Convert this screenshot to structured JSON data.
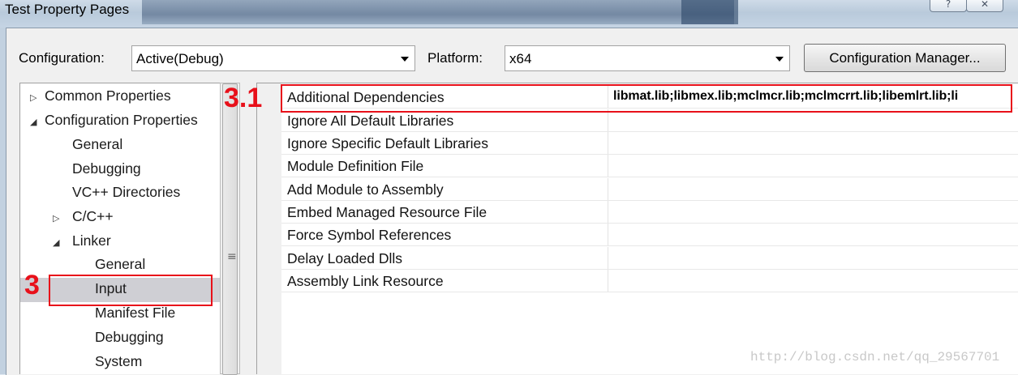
{
  "window": {
    "title": "Test Property Pages",
    "help_glyph": "?",
    "close_glyph": "✕"
  },
  "config_row": {
    "configuration_label": "Configuration:",
    "configuration_value": "Active(Debug)",
    "platform_label": "Platform:",
    "platform_value": "x64",
    "manager_button": "Configuration Manager..."
  },
  "tree": {
    "items": [
      {
        "label": "Common Properties",
        "twisty": "▷"
      },
      {
        "label": "Configuration Properties",
        "twisty": "◢"
      },
      {
        "label": "General",
        "twisty": ""
      },
      {
        "label": "Debugging",
        "twisty": ""
      },
      {
        "label": "VC++ Directories",
        "twisty": ""
      },
      {
        "label": "C/C++",
        "twisty": "▷"
      },
      {
        "label": "Linker",
        "twisty": "◢"
      },
      {
        "label": "General",
        "twisty": ""
      },
      {
        "label": "Input",
        "twisty": "",
        "selected": true
      },
      {
        "label": "Manifest File",
        "twisty": ""
      },
      {
        "label": "Debugging",
        "twisty": ""
      },
      {
        "label": "System",
        "twisty": ""
      }
    ],
    "scroll_grip": "≡"
  },
  "properties": {
    "rows": [
      {
        "name": "Additional Dependencies",
        "value": "libmat.lib;libmex.lib;mclmcr.lib;mclmcrrt.lib;libemlrt.lib;li"
      },
      {
        "name": "Ignore All Default Libraries",
        "value": ""
      },
      {
        "name": "Ignore Specific Default Libraries",
        "value": ""
      },
      {
        "name": "Module Definition File",
        "value": ""
      },
      {
        "name": "Add Module to Assembly",
        "value": ""
      },
      {
        "name": "Embed Managed Resource File",
        "value": ""
      },
      {
        "name": "Force Symbol References",
        "value": ""
      },
      {
        "name": "Delay Loaded Dlls",
        "value": ""
      },
      {
        "name": "Assembly Link Resource",
        "value": ""
      }
    ]
  },
  "annotations": {
    "tree_marker": "3",
    "grid_marker": "3.1",
    "color": "#e8101a"
  },
  "watermark": "http://blog.csdn.net/qq_29567701"
}
